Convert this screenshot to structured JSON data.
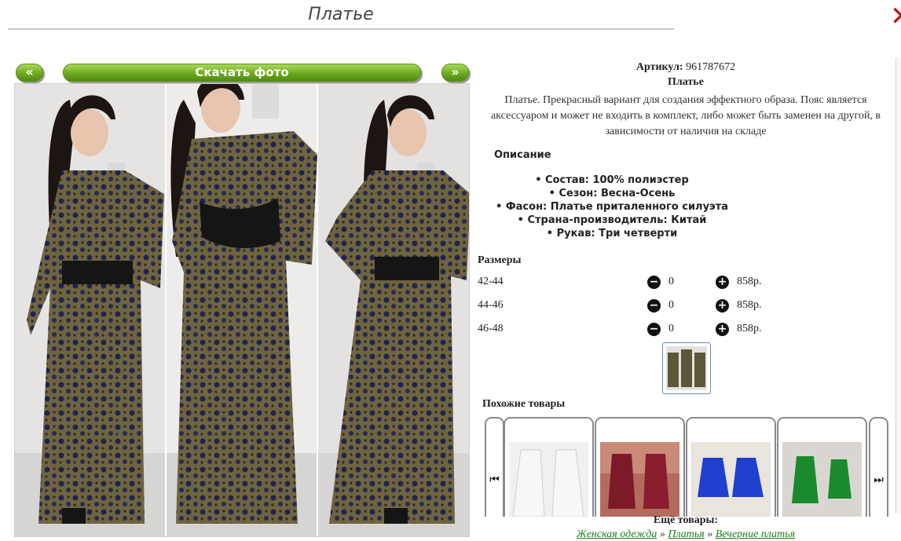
{
  "header": {
    "title": "Платье"
  },
  "gallery": {
    "prev_label": "«",
    "next_label": "»",
    "download_label": "Скачать фото"
  },
  "product": {
    "sku_label": "Артикул:",
    "sku_value": "961787672",
    "name": "Платье",
    "description": "Платье. Прекрасный вариант для создания эффектного образа. Пояс является аксессуаром и может не входить в комплект, либо может быть заменен на другой, в зависимости от наличия на складе"
  },
  "specs": {
    "heading": "Описание",
    "items": [
      "• Состав: 100% полиэстер",
      "• Сезон: Весна-Осень",
      "• Фасон: Платье приталенного силуэта",
      "• Страна-производитель: Китай",
      "• Рукав: Три четверти"
    ]
  },
  "sizes": {
    "heading": "Размеры",
    "rows": [
      {
        "label": "42-44",
        "qty": "0",
        "price": "858р."
      },
      {
        "label": "44-46",
        "qty": "0",
        "price": "858р."
      },
      {
        "label": "46-48",
        "qty": "0",
        "price": "858р."
      }
    ]
  },
  "similar": {
    "heading": "Похожие товары"
  },
  "more": {
    "heading": "Ещё товары:",
    "crumbs": [
      "Женская одежда",
      "Платья",
      "Вечерние платья"
    ],
    "separator": "»"
  },
  "colors": {
    "accent_green": "#6ea91f",
    "link_green": "#1e7b1e",
    "close_red": "#cc1111"
  }
}
